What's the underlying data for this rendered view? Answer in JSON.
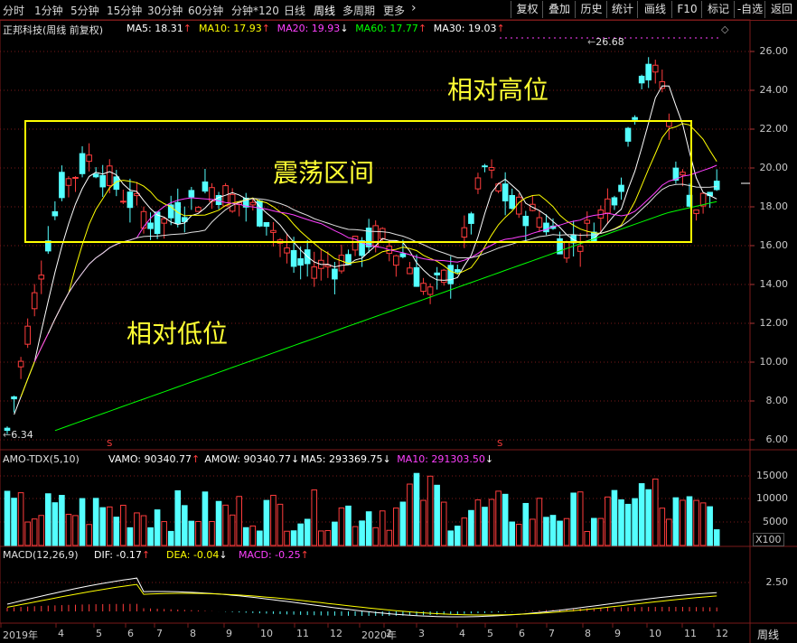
{
  "toolbar": {
    "periods": [
      "分时",
      "1分钟",
      "5分钟",
      "15分钟",
      "30分钟",
      "60分钟",
      "分钟*120",
      "日线",
      "周线",
      "多周期",
      "更多"
    ],
    "active": "周线",
    "right_buttons": [
      "复权",
      "叠加",
      "历史",
      "统计",
      "画线",
      "F10",
      "标记",
      "-自选",
      "返回"
    ]
  },
  "main": {
    "title": "正邦科技(周线 前复权)",
    "ma": [
      {
        "label": "MA5: 18.31",
        "arrow": "↑",
        "color": "#ffffff"
      },
      {
        "label": "MA10: 17.93",
        "arrow": "↑",
        "color": "#ffff00"
      },
      {
        "label": "MA20: 19.93",
        "arrow": "↓",
        "color": "#ff40ff"
      },
      {
        "label": "MA60: 17.77",
        "arrow": "↑",
        "color": "#00ff00"
      },
      {
        "label": "MA30: 19.03",
        "arrow": "↑",
        "color": "#ffffff"
      }
    ],
    "high_label": "26.68",
    "low_label": "6.34",
    "y_ticks": [
      "26.00",
      "24.00",
      "22.00",
      "20.00",
      "18.00",
      "16.00",
      "14.00",
      "12.00",
      "10.00",
      "8.00",
      "6.00"
    ],
    "annotations": {
      "high": "相对高位",
      "range": "震荡区间",
      "low": "相对低位"
    },
    "s_marker": "S"
  },
  "volume": {
    "title": "AMO-TDX(5,10)",
    "items": [
      {
        "label": "VAMO: 90340.77",
        "arrow": "↑",
        "color": "#ffffff"
      },
      {
        "label": "AMOW: 90340.77",
        "arrow": "↓",
        "color": "#ffffff"
      },
      {
        "label": "MA5: 293369.75",
        "arrow": "↓",
        "color": "#ffffff"
      },
      {
        "label": "MA10: 291303.50",
        "arrow": "↓",
        "color": "#ff40ff"
      }
    ],
    "y_ticks": [
      "15000",
      "10000",
      "5000"
    ],
    "unit": "X100"
  },
  "macd": {
    "title": "MACD(12,26,9)",
    "items": [
      {
        "label": "DIF: -0.17",
        "arrow": "↑",
        "color": "#ffffff"
      },
      {
        "label": "DEA: -0.04",
        "arrow": "↓",
        "color": "#ffff00"
      },
      {
        "label": "MACD: -0.25",
        "arrow": "↑",
        "color": "#ff40ff"
      }
    ],
    "y_ticks": [
      "2.50"
    ]
  },
  "xaxis": {
    "labels": [
      "2019年",
      "4",
      "5",
      "6",
      "7",
      "8",
      "9",
      "10",
      "11",
      "12",
      "2020年",
      "2",
      "3",
      "4",
      "5",
      "6",
      "7",
      "8",
      "9",
      "10",
      "11",
      "12"
    ]
  },
  "bottom_tab": "周线",
  "colors": {
    "up": "#ff3c3c",
    "down": "#54ffff",
    "grid": "#7a1a1a",
    "yellow": "#ffff00",
    "magenta": "#ff40ff",
    "green": "#00ff00",
    "white": "#ffffff"
  }
}
